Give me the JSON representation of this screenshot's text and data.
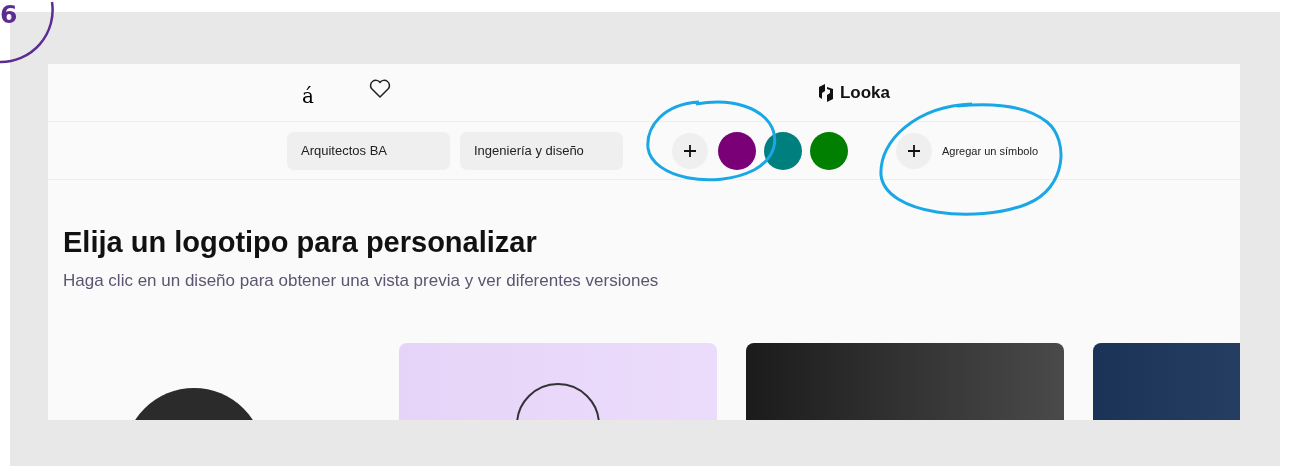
{
  "step": "6",
  "header": {
    "glyph": "á",
    "brand": "Looka"
  },
  "filters": [
    {
      "label": "Arquitectos BA"
    },
    {
      "label": "Ingeniería y diseño"
    }
  ],
  "colors": [
    {
      "color": "#7a0078"
    },
    {
      "color": "#007f7f"
    },
    {
      "color": "#007f00"
    }
  ],
  "add_symbol": {
    "label": "Agregar un símbolo"
  },
  "title": "Elija un logotipo para personalizar",
  "subtitle": "Haga clic en un diseño para obtener una vista previa y ver diferentes versiones"
}
